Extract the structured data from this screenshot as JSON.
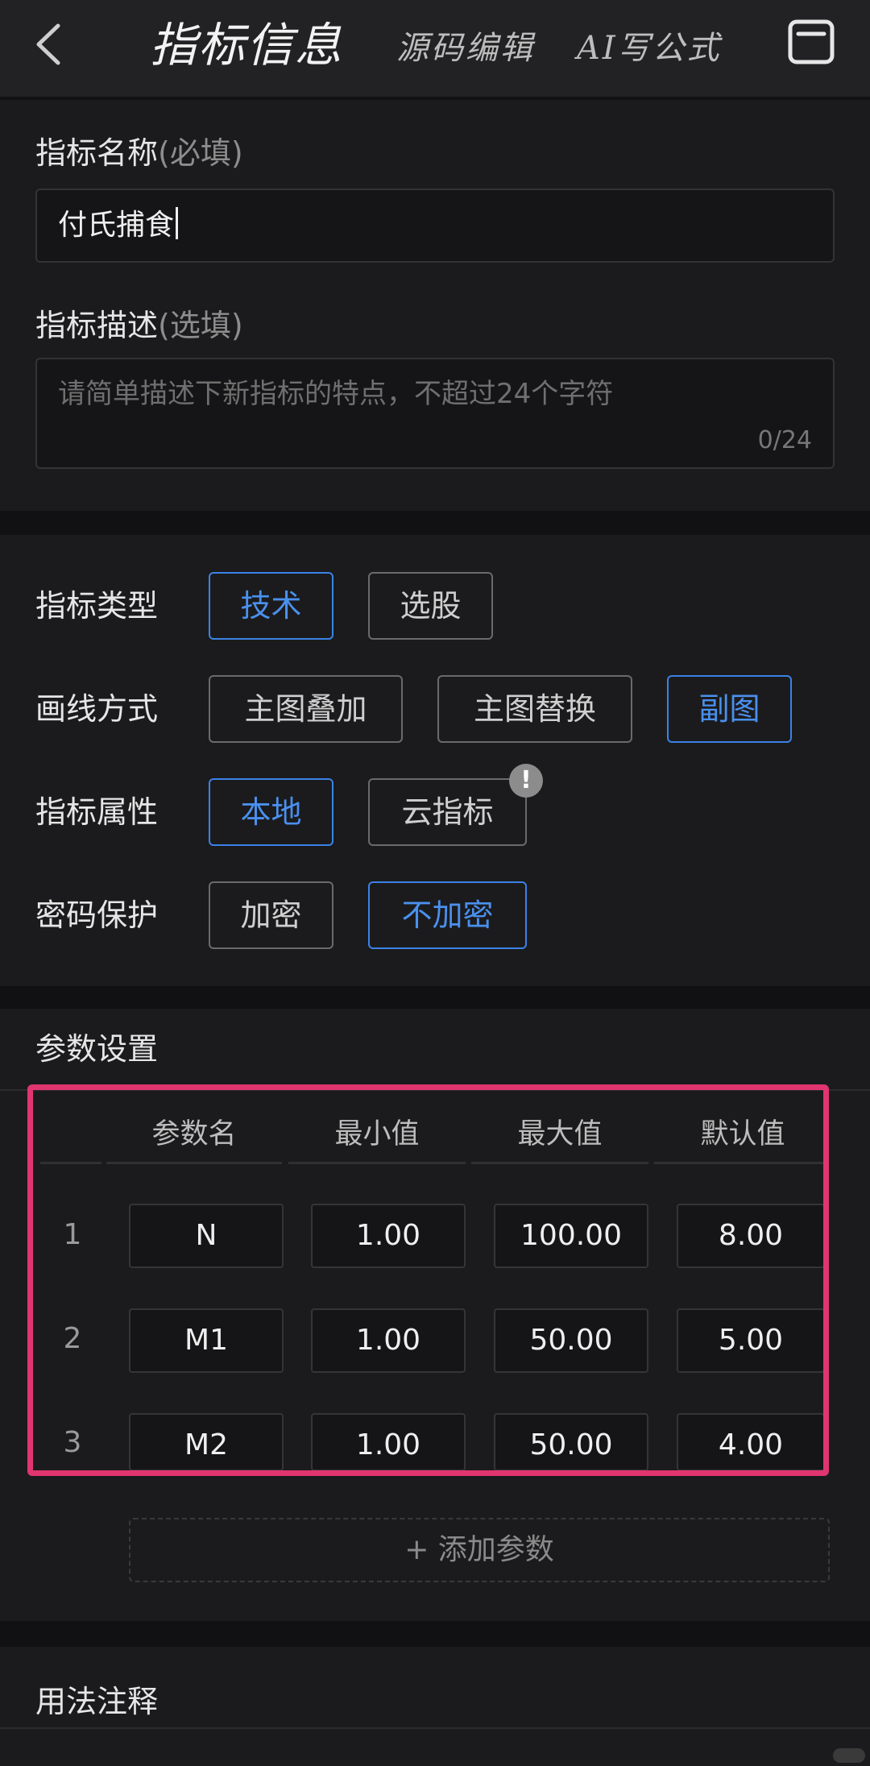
{
  "header": {
    "title": "指标信息",
    "tab_source": "源码编辑",
    "tab_ai": "AI写公式"
  },
  "basic": {
    "name_label": "指标名称",
    "name_hint": "(必填)",
    "name_value": "付氏捕食",
    "desc_label": "指标描述",
    "desc_hint": "(选填)",
    "desc_placeholder": "请简单描述下新指标的特点，不超过24个字符",
    "desc_counter": "0/24"
  },
  "options": {
    "type_label": "指标类型",
    "type_options": [
      "技术",
      "选股"
    ],
    "draw_label": "画线方式",
    "draw_options": [
      "主图叠加",
      "主图替换",
      "副图"
    ],
    "attr_label": "指标属性",
    "attr_options": [
      "本地",
      "云指标"
    ],
    "attr_badge": "!",
    "pwd_label": "密码保护",
    "pwd_options": [
      "加密",
      "不加密"
    ]
  },
  "params": {
    "title": "参数设置",
    "columns": [
      "参数名",
      "最小值",
      "最大值",
      "默认值"
    ],
    "rows": [
      {
        "num": "1",
        "name": "N",
        "min": "1.00",
        "max": "100.00",
        "default": "8.00"
      },
      {
        "num": "2",
        "name": "M1",
        "min": "1.00",
        "max": "50.00",
        "default": "5.00"
      },
      {
        "num": "3",
        "name": "M2",
        "min": "1.00",
        "max": "50.00",
        "default": "4.00"
      }
    ],
    "add_label": "+ 添加参数"
  },
  "usage": {
    "title": "用法注释"
  },
  "colors": {
    "accent": "#3b82e6",
    "highlight": "#e0356e",
    "background": "#111113"
  }
}
